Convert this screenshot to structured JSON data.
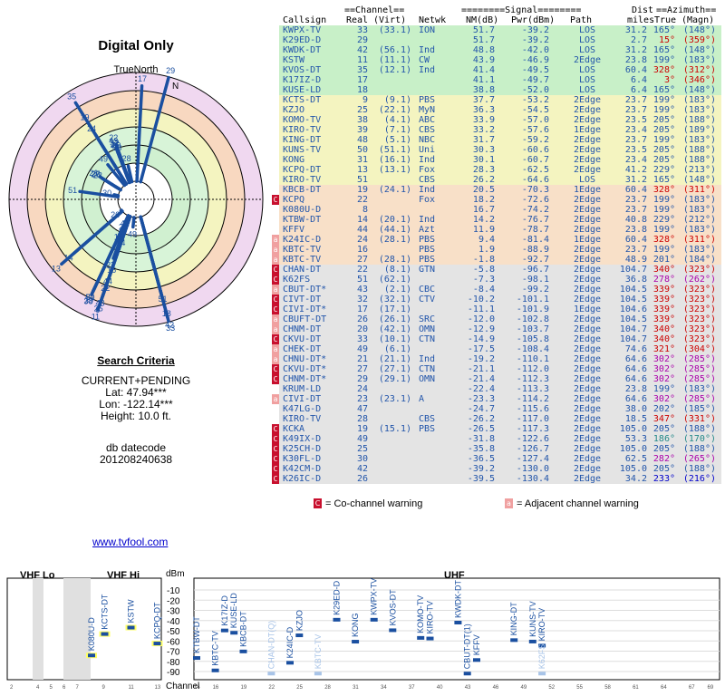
{
  "left": {
    "title": "Digital Only",
    "north_label": "TrueNorth",
    "n_label": "N",
    "search_heading": "Search Criteria",
    "mode": "CURRENT+PENDING",
    "lat": "Lat: 47.94***",
    "lon": "Lon: -122.14***",
    "height": "Height: 10.0 ft.",
    "db_label": "db datecode",
    "db_value": "201208240638",
    "link": "www.tvfool.com"
  },
  "header": {
    "line1_parts": [
      "",
      "==Channel==",
      "",
      "========Signal========",
      "",
      "Dist",
      "==Azimuth=="
    ],
    "cols": [
      "Callsign",
      "Real",
      "(Virt)",
      "Netwk",
      "NM(dB)",
      "Pwr(dBm)",
      "Path",
      "miles",
      "True",
      "(Magn)"
    ]
  },
  "rows": [
    {
      "call": "KWPX-TV",
      "real": "33",
      "virt": "(33.1)",
      "net": "ION",
      "nm": "51.7",
      "pwr": "-39.2",
      "path": "LOS",
      "dist": "31.2",
      "az": "165°",
      "mag": "(148°)",
      "w": "",
      "bg": "#c8f0c8",
      "fg": "#2255aa"
    },
    {
      "call": "K29ED-D",
      "real": "29",
      "virt": "",
      "net": "",
      "nm": "51.7",
      "pwr": "-39.2",
      "path": "LOS",
      "dist": "2.7",
      "az": "15°",
      "mag": "(359°)",
      "w": "",
      "bg": "#c8f0c8",
      "fg": "#2255aa",
      "azc": "#cc0000"
    },
    {
      "call": "KWDK-DT",
      "real": "42",
      "virt": "(56.1)",
      "net": "Ind",
      "nm": "48.8",
      "pwr": "-42.0",
      "path": "LOS",
      "dist": "31.2",
      "az": "165°",
      "mag": "(148°)",
      "w": "",
      "bg": "#c8f0c8",
      "fg": "#2255aa"
    },
    {
      "call": "KSTW",
      "real": "11",
      "virt": "(11.1)",
      "net": "CW",
      "nm": "43.9",
      "pwr": "-46.9",
      "path": "2Edge",
      "dist": "23.8",
      "az": "199°",
      "mag": "(183°)",
      "w": "",
      "bg": "#c8f0c8",
      "fg": "#2255aa"
    },
    {
      "call": "KVOS-DT",
      "real": "35",
      "virt": "(12.1)",
      "net": "Ind",
      "nm": "41.4",
      "pwr": "-49.5",
      "path": "LOS",
      "dist": "60.4",
      "az": "328°",
      "mag": "(312°)",
      "w": "",
      "bg": "#c8f0c8",
      "fg": "#2255aa",
      "azc": "#cc0000"
    },
    {
      "call": "K17IZ-D",
      "real": "17",
      "virt": "",
      "net": "",
      "nm": "41.1",
      "pwr": "-49.7",
      "path": "LOS",
      "dist": "6.4",
      "az": "3°",
      "mag": "(346°)",
      "w": "",
      "bg": "#c8f0c8",
      "fg": "#2255aa",
      "azc": "#cc0000"
    },
    {
      "call": "KUSE-LD",
      "real": "18",
      "virt": "",
      "net": "",
      "nm": "38.8",
      "pwr": "-52.0",
      "path": "LOS",
      "dist": "6.4",
      "az": "165°",
      "mag": "(148°)",
      "w": "",
      "bg": "#c8f0c8",
      "fg": "#2255aa"
    },
    {
      "call": "KCTS-DT",
      "real": "9",
      "virt": "(9.1)",
      "net": "PBS",
      "nm": "37.7",
      "pwr": "-53.2",
      "path": "2Edge",
      "dist": "23.7",
      "az": "199°",
      "mag": "(183°)",
      "w": "",
      "bg": "#f4f4c0",
      "fg": "#2255aa"
    },
    {
      "call": "KZJO",
      "real": "25",
      "virt": "(22.1)",
      "net": "MyN",
      "nm": "36.3",
      "pwr": "-54.5",
      "path": "2Edge",
      "dist": "23.7",
      "az": "199°",
      "mag": "(183°)",
      "w": "",
      "bg": "#f4f4c0",
      "fg": "#2255aa"
    },
    {
      "call": "KOMO-TV",
      "real": "38",
      "virt": "(4.1)",
      "net": "ABC",
      "nm": "33.9",
      "pwr": "-57.0",
      "path": "2Edge",
      "dist": "23.5",
      "az": "205°",
      "mag": "(188°)",
      "w": "",
      "bg": "#f4f4c0",
      "fg": "#2255aa"
    },
    {
      "call": "KIRO-TV",
      "real": "39",
      "virt": "(7.1)",
      "net": "CBS",
      "nm": "33.2",
      "pwr": "-57.6",
      "path": "1Edge",
      "dist": "23.4",
      "az": "205°",
      "mag": "(189°)",
      "w": "",
      "bg": "#f4f4c0",
      "fg": "#2255aa"
    },
    {
      "call": "KING-DT",
      "real": "48",
      "virt": "(5.1)",
      "net": "NBC",
      "nm": "31.7",
      "pwr": "-59.2",
      "path": "2Edge",
      "dist": "23.7",
      "az": "199°",
      "mag": "(183°)",
      "w": "",
      "bg": "#f4f4c0",
      "fg": "#2255aa"
    },
    {
      "call": "KUNS-TV",
      "real": "50",
      "virt": "(51.1)",
      "net": "Uni",
      "nm": "30.3",
      "pwr": "-60.6",
      "path": "2Edge",
      "dist": "23.5",
      "az": "205°",
      "mag": "(188°)",
      "w": "",
      "bg": "#f4f4c0",
      "fg": "#2255aa"
    },
    {
      "call": "KONG",
      "real": "31",
      "virt": "(16.1)",
      "net": "Ind",
      "nm": "30.1",
      "pwr": "-60.7",
      "path": "2Edge",
      "dist": "23.4",
      "az": "205°",
      "mag": "(188°)",
      "w": "",
      "bg": "#f4f4c0",
      "fg": "#2255aa"
    },
    {
      "call": "KCPQ-DT",
      "real": "13",
      "virt": "(13.1)",
      "net": "Fox",
      "nm": "28.3",
      "pwr": "-62.5",
      "path": "2Edge",
      "dist": "41.2",
      "az": "229°",
      "mag": "(213°)",
      "w": "",
      "bg": "#f4f4c0",
      "fg": "#2255aa"
    },
    {
      "call": "KIRO-TV",
      "real": "51",
      "virt": "",
      "net": "CBS",
      "nm": "26.2",
      "pwr": "-64.6",
      "path": "LOS",
      "dist": "31.2",
      "az": "165°",
      "mag": "(148°)",
      "w": "",
      "bg": "#f4f4c0",
      "fg": "#2255aa"
    },
    {
      "call": "KBCB-DT",
      "real": "19",
      "virt": "(24.1)",
      "net": "Ind",
      "nm": "20.5",
      "pwr": "-70.3",
      "path": "1Edge",
      "dist": "60.4",
      "az": "328°",
      "mag": "(311°)",
      "w": "",
      "bg": "#f8e0c8",
      "fg": "#2255aa",
      "azc": "#cc0000"
    },
    {
      "call": "KCPQ",
      "real": "22",
      "virt": "",
      "net": "Fox",
      "nm": "18.2",
      "pwr": "-72.6",
      "path": "2Edge",
      "dist": "23.7",
      "az": "199°",
      "mag": "(183°)",
      "w": "C",
      "bg": "#f8e0c8",
      "fg": "#2255aa"
    },
    {
      "call": "K080U-D",
      "real": "8",
      "virt": "",
      "net": "",
      "nm": "16.7",
      "pwr": "-74.2",
      "path": "2Edge",
      "dist": "23.7",
      "az": "199°",
      "mag": "(183°)",
      "w": "",
      "bg": "#f8e0c8",
      "fg": "#2255aa"
    },
    {
      "call": "KTBW-DT",
      "real": "14",
      "virt": "(20.1)",
      "net": "Ind",
      "nm": "14.2",
      "pwr": "-76.7",
      "path": "2Edge",
      "dist": "40.8",
      "az": "229°",
      "mag": "(212°)",
      "w": "",
      "bg": "#f8e0c8",
      "fg": "#2255aa"
    },
    {
      "call": "KFFV",
      "real": "44",
      "virt": "(44.1)",
      "net": "Azt",
      "nm": "11.9",
      "pwr": "-78.7",
      "path": "2Edge",
      "dist": "23.8",
      "az": "199°",
      "mag": "(183°)",
      "w": "",
      "bg": "#f8e0c8",
      "fg": "#2255aa"
    },
    {
      "call": "K24IC-D",
      "real": "24",
      "virt": "(28.1)",
      "net": "PBS",
      "nm": "9.4",
      "pwr": "-81.4",
      "path": "1Edge",
      "dist": "60.4",
      "az": "328°",
      "mag": "(311°)",
      "w": "a",
      "bg": "#f8e0c8",
      "fg": "#2255aa",
      "azc": "#cc0000"
    },
    {
      "call": "KBTC-TV",
      "real": "16",
      "virt": "",
      "net": "PBS",
      "nm": "1.9",
      "pwr": "-88.9",
      "path": "2Edge",
      "dist": "23.7",
      "az": "199°",
      "mag": "(183°)",
      "w": "a",
      "bg": "#f8e0c8",
      "fg": "#2255aa"
    },
    {
      "call": "KBTC-TV",
      "real": "27",
      "virt": "(28.1)",
      "net": "PBS",
      "nm": "-1.8",
      "pwr": "-92.7",
      "path": "2Edge",
      "dist": "48.9",
      "az": "201°",
      "mag": "(184°)",
      "w": "a",
      "bg": "#f8e0c8",
      "fg": "#2255aa"
    },
    {
      "call": "CHAN-DT",
      "real": "22",
      "virt": "(8.1)",
      "net": "GTN",
      "nm": "-5.8",
      "pwr": "-96.7",
      "path": "2Edge",
      "dist": "104.7",
      "az": "340°",
      "mag": "(323°)",
      "w": "C",
      "bg": "#e4e4e4",
      "fg": "#2255aa",
      "azc": "#cc0000"
    },
    {
      "call": "K62FS",
      "real": "51",
      "virt": "(62.1)",
      "net": "",
      "nm": "-7.3",
      "pwr": "-98.1",
      "path": "2Edge",
      "dist": "36.8",
      "az": "278°",
      "mag": "(262°)",
      "w": "C",
      "bg": "#e4e4e4",
      "fg": "#2255aa",
      "azc": "#aa00aa"
    },
    {
      "call": "CBUT-DT*",
      "real": "43",
      "virt": "(2.1)",
      "net": "CBC",
      "nm": "-8.4",
      "pwr": "-99.2",
      "path": "2Edge",
      "dist": "104.5",
      "az": "339°",
      "mag": "(323°)",
      "w": "a",
      "bg": "#e4e4e4",
      "fg": "#2255aa",
      "azc": "#cc0000"
    },
    {
      "call": "CIVT-DT",
      "real": "32",
      "virt": "(32.1)",
      "net": "CTV",
      "nm": "-10.2",
      "pwr": "-101.1",
      "path": "2Edge",
      "dist": "104.5",
      "az": "339°",
      "mag": "(323°)",
      "w": "C",
      "bg": "#e4e4e4",
      "fg": "#2255aa",
      "azc": "#cc0000"
    },
    {
      "call": "CIVI-DT*",
      "real": "17",
      "virt": "(17.1)",
      "net": "",
      "nm": "-11.1",
      "pwr": "-101.9",
      "path": "1Edge",
      "dist": "104.6",
      "az": "339°",
      "mag": "(323°)",
      "w": "C",
      "bg": "#e4e4e4",
      "fg": "#2255aa",
      "azc": "#cc0000"
    },
    {
      "call": "CBUFT-DT",
      "real": "26",
      "virt": "(26.1)",
      "net": "SRC",
      "nm": "-12.0",
      "pwr": "-102.8",
      "path": "2Edge",
      "dist": "104.5",
      "az": "339°",
      "mag": "(323°)",
      "w": "a",
      "bg": "#e4e4e4",
      "fg": "#2255aa",
      "azc": "#cc0000"
    },
    {
      "call": "CHNM-DT",
      "real": "20",
      "virt": "(42.1)",
      "net": "OMN",
      "nm": "-12.9",
      "pwr": "-103.7",
      "path": "2Edge",
      "dist": "104.7",
      "az": "340°",
      "mag": "(323°)",
      "w": "a",
      "bg": "#e4e4e4",
      "fg": "#2255aa",
      "azc": "#cc0000"
    },
    {
      "call": "CKVU-DT",
      "real": "33",
      "virt": "(10.1)",
      "net": "CTN",
      "nm": "-14.9",
      "pwr": "-105.8",
      "path": "2Edge",
      "dist": "104.7",
      "az": "340°",
      "mag": "(323°)",
      "w": "C",
      "bg": "#e4e4e4",
      "fg": "#2255aa",
      "azc": "#cc0000"
    },
    {
      "call": "CHEK-DT",
      "real": "49",
      "virt": "(6.1)",
      "net": "",
      "nm": "-17.5",
      "pwr": "-108.4",
      "path": "2Edge",
      "dist": "74.6",
      "az": "321°",
      "mag": "(304°)",
      "w": "a",
      "bg": "#e4e4e4",
      "fg": "#2255aa",
      "azc": "#cc0000"
    },
    {
      "call": "CHNU-DT*",
      "real": "21",
      "virt": "(21.1)",
      "net": "Ind",
      "nm": "-19.2",
      "pwr": "-110.1",
      "path": "2Edge",
      "dist": "64.6",
      "az": "302°",
      "mag": "(285°)",
      "w": "a",
      "bg": "#e4e4e4",
      "fg": "#2255aa",
      "azc": "#aa00aa"
    },
    {
      "call": "CKVU-DT*",
      "real": "27",
      "virt": "(27.1)",
      "net": "CTN",
      "nm": "-21.1",
      "pwr": "-112.0",
      "path": "2Edge",
      "dist": "64.6",
      "az": "302°",
      "mag": "(285°)",
      "w": "C",
      "bg": "#e4e4e4",
      "fg": "#2255aa",
      "azc": "#aa00aa"
    },
    {
      "call": "CHNM-DT*",
      "real": "29",
      "virt": "(29.1)",
      "net": "OMN",
      "nm": "-21.4",
      "pwr": "-112.3",
      "path": "2Edge",
      "dist": "64.6",
      "az": "302°",
      "mag": "(285°)",
      "w": "C",
      "bg": "#e4e4e4",
      "fg": "#2255aa",
      "azc": "#aa00aa"
    },
    {
      "call": "KRUM-LD",
      "real": "24",
      "virt": "",
      "net": "",
      "nm": "-22.4",
      "pwr": "-113.3",
      "path": "2Edge",
      "dist": "23.8",
      "az": "199°",
      "mag": "(183°)",
      "w": "",
      "bg": "#e4e4e4",
      "fg": "#2255aa"
    },
    {
      "call": "CIVI-DT",
      "real": "23",
      "virt": "(23.1)",
      "net": "A",
      "nm": "-23.3",
      "pwr": "-114.2",
      "path": "2Edge",
      "dist": "64.6",
      "az": "302°",
      "mag": "(285°)",
      "w": "a",
      "bg": "#e4e4e4",
      "fg": "#2255aa",
      "azc": "#aa00aa"
    },
    {
      "call": "K47LG-D",
      "real": "47",
      "virt": "",
      "net": "",
      "nm": "-24.7",
      "pwr": "-115.6",
      "path": "2Edge",
      "dist": "38.0",
      "az": "202°",
      "mag": "(185°)",
      "w": "",
      "bg": "#e4e4e4",
      "fg": "#2255aa"
    },
    {
      "call": "KIRO-TV",
      "real": "28",
      "virt": "",
      "net": "CBS",
      "nm": "-26.2",
      "pwr": "-117.0",
      "path": "2Edge",
      "dist": "18.5",
      "az": "347°",
      "mag": "(331°)",
      "w": "",
      "bg": "#e4e4e4",
      "fg": "#2255aa",
      "azc": "#cc0000"
    },
    {
      "call": "KCKA",
      "real": "19",
      "virt": "(15.1)",
      "net": "PBS",
      "nm": "-26.5",
      "pwr": "-117.3",
      "path": "2Edge",
      "dist": "105.0",
      "az": "205°",
      "mag": "(188°)",
      "w": "C",
      "bg": "#e4e4e4",
      "fg": "#2255aa"
    },
    {
      "call": "K49IX-D",
      "real": "49",
      "virt": "",
      "net": "",
      "nm": "-31.8",
      "pwr": "-122.6",
      "path": "2Edge",
      "dist": "53.3",
      "az": "186°",
      "mag": "(170°)",
      "w": "C",
      "bg": "#e4e4e4",
      "fg": "#2255aa",
      "azc": "#228888"
    },
    {
      "call": "K25CH-D",
      "real": "25",
      "virt": "",
      "net": "",
      "nm": "-35.8",
      "pwr": "-126.7",
      "path": "2Edge",
      "dist": "105.0",
      "az": "205°",
      "mag": "(188°)",
      "w": "C",
      "bg": "#e4e4e4",
      "fg": "#2255aa"
    },
    {
      "call": "K30FL-D",
      "real": "30",
      "virt": "",
      "net": "",
      "nm": "-36.5",
      "pwr": "-127.4",
      "path": "2Edge",
      "dist": "62.5",
      "az": "282°",
      "mag": "(265°)",
      "w": "C",
      "bg": "#e4e4e4",
      "fg": "#2255aa",
      "azc": "#aa00aa"
    },
    {
      "call": "K42CM-D",
      "real": "42",
      "virt": "",
      "net": "",
      "nm": "-39.2",
      "pwr": "-130.0",
      "path": "2Edge",
      "dist": "105.0",
      "az": "205°",
      "mag": "(188°)",
      "w": "C",
      "bg": "#e4e4e4",
      "fg": "#2255aa"
    },
    {
      "call": "K26IC-D",
      "real": "26",
      "virt": "",
      "net": "",
      "nm": "-39.5",
      "pwr": "-130.4",
      "path": "2Edge",
      "dist": "34.2",
      "az": "233°",
      "mag": "(216°)",
      "w": "C",
      "bg": "#e4e4e4",
      "fg": "#2255aa",
      "azc": "#0000cc"
    }
  ],
  "legend": {
    "co_box": "C",
    "co_text": "= Co-channel warning",
    "adj_box": "a",
    "adj_text": "= Adjacent channel warning"
  },
  "spectrum": {
    "vhf_lo": "VHF Lo",
    "vhf_hi": "VHF Hi",
    "uhf": "UHF",
    "dbm": "dBm",
    "channel": "Channel",
    "db_ticks": [
      "-10",
      "-20",
      "-30",
      "-40",
      "-50",
      "-60",
      "-70",
      "-80",
      "-90"
    ],
    "vhf_ticks": [
      "2",
      "4",
      "5",
      "6",
      "7",
      "9",
      "11",
      "13"
    ],
    "uhf_ticks": [
      "14",
      "16",
      "19",
      "22",
      "25",
      "28",
      "31",
      "34",
      "37",
      "40",
      "43",
      "46",
      "49",
      "52",
      "55",
      "58",
      "61",
      "64",
      "67",
      "69"
    ],
    "vhf_stations": [
      {
        "call": "K080U-D",
        "ch": 8,
        "pwr": -74.2
      },
      {
        "call": "KCTS-DT",
        "ch": 9,
        "pwr": -53.2
      },
      {
        "call": "KSTW",
        "ch": 11,
        "pwr": -46.9
      },
      {
        "call": "KCPQ-DT",
        "ch": 13,
        "pwr": -62.5
      }
    ],
    "uhf_stations": [
      {
        "call": "KTBW-DT",
        "ch": 14,
        "pwr": -76.7
      },
      {
        "call": "KBTC-TV",
        "ch": 16,
        "pwr": -88.9
      },
      {
        "call": "K17IZ-D",
        "ch": 17,
        "pwr": -49.7
      },
      {
        "call": "KUSE-LD",
        "ch": 18,
        "pwr": -52.0
      },
      {
        "call": "KBCB-DT",
        "ch": 19,
        "pwr": -70.3
      },
      {
        "call": "CHAN-DT(Q)",
        "ch": 22,
        "pwr": -96.7,
        "faint": true
      },
      {
        "call": "K24IC-D",
        "ch": 24,
        "pwr": -81.4
      },
      {
        "call": "KZJO",
        "ch": 25,
        "pwr": -54.5
      },
      {
        "call": "KBTC-TV",
        "ch": 27,
        "pwr": -92.7,
        "faint": true
      },
      {
        "call": "K29ED-D",
        "ch": 29,
        "pwr": -39.2
      },
      {
        "call": "KONG",
        "ch": 31,
        "pwr": -60.7
      },
      {
        "call": "KWPX-TV",
        "ch": 33,
        "pwr": -39.2
      },
      {
        "call": "KVOS-DT",
        "ch": 35,
        "pwr": -49.5
      },
      {
        "call": "KOMO-TV",
        "ch": 38,
        "pwr": -57.0
      },
      {
        "call": "KIRO-TV",
        "ch": 39,
        "pwr": -57.6
      },
      {
        "call": "KWDK-DT",
        "ch": 42,
        "pwr": -42.0
      },
      {
        "call": "CBUT-DT(1)",
        "ch": 43,
        "pwr": -99.2
      },
      {
        "call": "KFFV",
        "ch": 44,
        "pwr": -78.7
      },
      {
        "call": "KING-DT",
        "ch": 48,
        "pwr": -59.2
      },
      {
        "call": "KUNS-TV",
        "ch": 50,
        "pwr": -60.6
      },
      {
        "call": "KIRO-TV",
        "ch": 51,
        "pwr": -64.6
      },
      {
        "call": "K62FS",
        "ch": 51,
        "pwr": -98.1,
        "faint": true
      }
    ]
  }
}
